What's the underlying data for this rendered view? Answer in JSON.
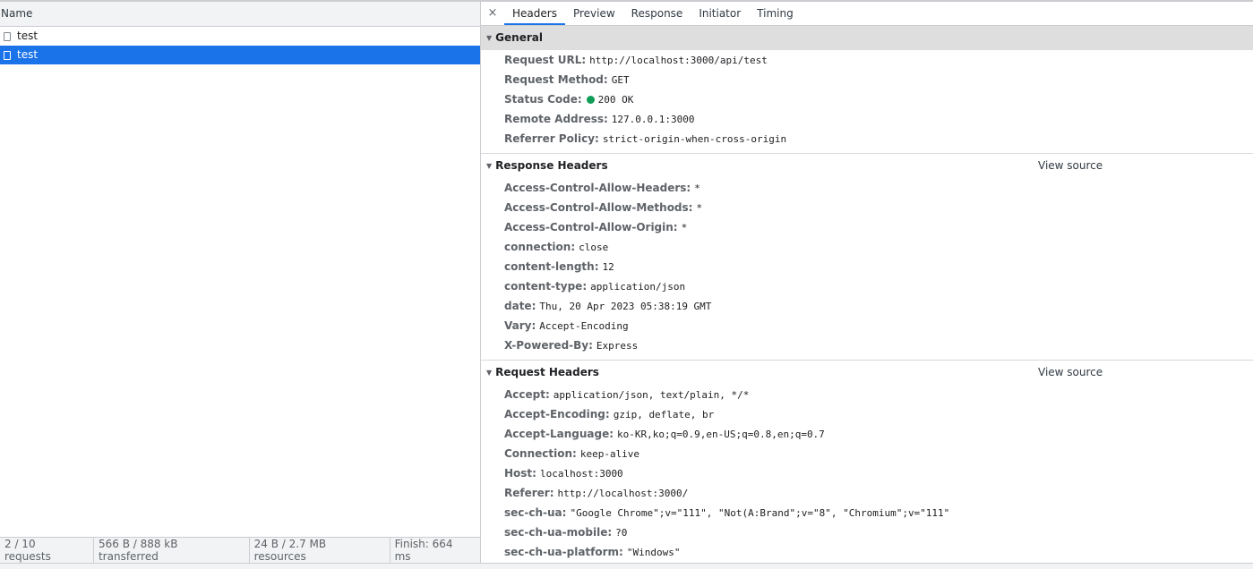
{
  "request_list": {
    "column_name": "Name",
    "rows": [
      {
        "name": "test",
        "selected": false
      },
      {
        "name": "test",
        "selected": true
      }
    ]
  },
  "summary": {
    "requests": "2 / 10 requests",
    "transferred": "566 B / 888 kB transferred",
    "resources": "24 B / 2.7 MB resources",
    "finish": "Finish: 664 ms"
  },
  "tabs": {
    "close": "×",
    "items": [
      "Headers",
      "Preview",
      "Response",
      "Initiator",
      "Timing"
    ],
    "active": "Headers"
  },
  "general": {
    "title": "General",
    "rows": [
      {
        "key": "Request URL:",
        "value": "http://localhost:3000/api/test"
      },
      {
        "key": "Request Method:",
        "value": "GET"
      },
      {
        "key": "Status Code:",
        "value": "200 OK"
      },
      {
        "key": "Remote Address:",
        "value": "127.0.0.1:3000"
      },
      {
        "key": "Referrer Policy:",
        "value": "strict-origin-when-cross-origin"
      }
    ]
  },
  "response_headers": {
    "title": "Response Headers",
    "view_source": "View source",
    "rows": [
      {
        "key": "Access-Control-Allow-Headers:",
        "value": "*"
      },
      {
        "key": "Access-Control-Allow-Methods:",
        "value": "*"
      },
      {
        "key": "Access-Control-Allow-Origin:",
        "value": "*"
      },
      {
        "key": "connection:",
        "value": "close"
      },
      {
        "key": "content-length:",
        "value": "12"
      },
      {
        "key": "content-type:",
        "value": "application/json"
      },
      {
        "key": "date:",
        "value": "Thu, 20 Apr 2023 05:38:19 GMT"
      },
      {
        "key": "Vary:",
        "value": "Accept-Encoding"
      },
      {
        "key": "X-Powered-By:",
        "value": "Express"
      }
    ]
  },
  "request_headers": {
    "title": "Request Headers",
    "view_source": "View source",
    "rows": [
      {
        "key": "Accept:",
        "value": "application/json, text/plain, */*"
      },
      {
        "key": "Accept-Encoding:",
        "value": "gzip, deflate, br"
      },
      {
        "key": "Accept-Language:",
        "value": "ko-KR,ko;q=0.9,en-US;q=0.8,en;q=0.7"
      },
      {
        "key": "Connection:",
        "value": "keep-alive"
      },
      {
        "key": "Host:",
        "value": "localhost:3000"
      },
      {
        "key": "Referer:",
        "value": "http://localhost:3000/"
      },
      {
        "key": "sec-ch-ua:",
        "value": "\"Google Chrome\";v=\"111\", \"Not(A:Brand\";v=\"8\", \"Chromium\";v=\"111\""
      },
      {
        "key": "sec-ch-ua-mobile:",
        "value": "?0"
      },
      {
        "key": "sec-ch-ua-platform:",
        "value": "\"Windows\""
      }
    ]
  },
  "colors": {
    "selection": "#1a73e8",
    "status_ok": "#0f9d58",
    "panel_bg": "#f1f3f4"
  },
  "icons": {
    "close": "close-icon",
    "expand": "triangle-down-icon",
    "status": "status-dot-icon",
    "document": "document-icon"
  }
}
